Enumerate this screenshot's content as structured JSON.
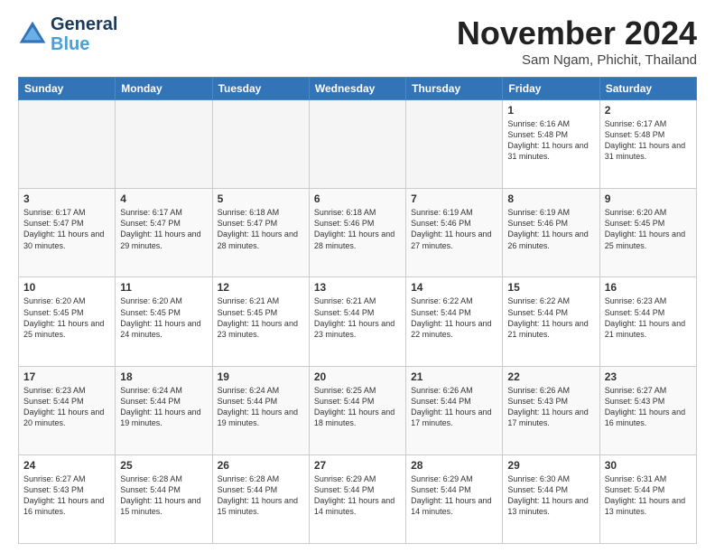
{
  "header": {
    "logo_line1": "General",
    "logo_line2": "Blue",
    "title": "November 2024",
    "location": "Sam Ngam, Phichit, Thailand"
  },
  "weekdays": [
    "Sunday",
    "Monday",
    "Tuesday",
    "Wednesday",
    "Thursday",
    "Friday",
    "Saturday"
  ],
  "weeks": [
    [
      {
        "day": "",
        "info": ""
      },
      {
        "day": "",
        "info": ""
      },
      {
        "day": "",
        "info": ""
      },
      {
        "day": "",
        "info": ""
      },
      {
        "day": "",
        "info": ""
      },
      {
        "day": "1",
        "info": "Sunrise: 6:16 AM\nSunset: 5:48 PM\nDaylight: 11 hours\nand 31 minutes."
      },
      {
        "day": "2",
        "info": "Sunrise: 6:17 AM\nSunset: 5:48 PM\nDaylight: 11 hours\nand 31 minutes."
      }
    ],
    [
      {
        "day": "3",
        "info": "Sunrise: 6:17 AM\nSunset: 5:47 PM\nDaylight: 11 hours\nand 30 minutes."
      },
      {
        "day": "4",
        "info": "Sunrise: 6:17 AM\nSunset: 5:47 PM\nDaylight: 11 hours\nand 29 minutes."
      },
      {
        "day": "5",
        "info": "Sunrise: 6:18 AM\nSunset: 5:47 PM\nDaylight: 11 hours\nand 28 minutes."
      },
      {
        "day": "6",
        "info": "Sunrise: 6:18 AM\nSunset: 5:46 PM\nDaylight: 11 hours\nand 28 minutes."
      },
      {
        "day": "7",
        "info": "Sunrise: 6:19 AM\nSunset: 5:46 PM\nDaylight: 11 hours\nand 27 minutes."
      },
      {
        "day": "8",
        "info": "Sunrise: 6:19 AM\nSunset: 5:46 PM\nDaylight: 11 hours\nand 26 minutes."
      },
      {
        "day": "9",
        "info": "Sunrise: 6:20 AM\nSunset: 5:45 PM\nDaylight: 11 hours\nand 25 minutes."
      }
    ],
    [
      {
        "day": "10",
        "info": "Sunrise: 6:20 AM\nSunset: 5:45 PM\nDaylight: 11 hours\nand 25 minutes."
      },
      {
        "day": "11",
        "info": "Sunrise: 6:20 AM\nSunset: 5:45 PM\nDaylight: 11 hours\nand 24 minutes."
      },
      {
        "day": "12",
        "info": "Sunrise: 6:21 AM\nSunset: 5:45 PM\nDaylight: 11 hours\nand 23 minutes."
      },
      {
        "day": "13",
        "info": "Sunrise: 6:21 AM\nSunset: 5:44 PM\nDaylight: 11 hours\nand 23 minutes."
      },
      {
        "day": "14",
        "info": "Sunrise: 6:22 AM\nSunset: 5:44 PM\nDaylight: 11 hours\nand 22 minutes."
      },
      {
        "day": "15",
        "info": "Sunrise: 6:22 AM\nSunset: 5:44 PM\nDaylight: 11 hours\nand 21 minutes."
      },
      {
        "day": "16",
        "info": "Sunrise: 6:23 AM\nSunset: 5:44 PM\nDaylight: 11 hours\nand 21 minutes."
      }
    ],
    [
      {
        "day": "17",
        "info": "Sunrise: 6:23 AM\nSunset: 5:44 PM\nDaylight: 11 hours\nand 20 minutes."
      },
      {
        "day": "18",
        "info": "Sunrise: 6:24 AM\nSunset: 5:44 PM\nDaylight: 11 hours\nand 19 minutes."
      },
      {
        "day": "19",
        "info": "Sunrise: 6:24 AM\nSunset: 5:44 PM\nDaylight: 11 hours\nand 19 minutes."
      },
      {
        "day": "20",
        "info": "Sunrise: 6:25 AM\nSunset: 5:44 PM\nDaylight: 11 hours\nand 18 minutes."
      },
      {
        "day": "21",
        "info": "Sunrise: 6:26 AM\nSunset: 5:44 PM\nDaylight: 11 hours\nand 17 minutes."
      },
      {
        "day": "22",
        "info": "Sunrise: 6:26 AM\nSunset: 5:43 PM\nDaylight: 11 hours\nand 17 minutes."
      },
      {
        "day": "23",
        "info": "Sunrise: 6:27 AM\nSunset: 5:43 PM\nDaylight: 11 hours\nand 16 minutes."
      }
    ],
    [
      {
        "day": "24",
        "info": "Sunrise: 6:27 AM\nSunset: 5:43 PM\nDaylight: 11 hours\nand 16 minutes."
      },
      {
        "day": "25",
        "info": "Sunrise: 6:28 AM\nSunset: 5:44 PM\nDaylight: 11 hours\nand 15 minutes."
      },
      {
        "day": "26",
        "info": "Sunrise: 6:28 AM\nSunset: 5:44 PM\nDaylight: 11 hours\nand 15 minutes."
      },
      {
        "day": "27",
        "info": "Sunrise: 6:29 AM\nSunset: 5:44 PM\nDaylight: 11 hours\nand 14 minutes."
      },
      {
        "day": "28",
        "info": "Sunrise: 6:29 AM\nSunset: 5:44 PM\nDaylight: 11 hours\nand 14 minutes."
      },
      {
        "day": "29",
        "info": "Sunrise: 6:30 AM\nSunset: 5:44 PM\nDaylight: 11 hours\nand 13 minutes."
      },
      {
        "day": "30",
        "info": "Sunrise: 6:31 AM\nSunset: 5:44 PM\nDaylight: 11 hours\nand 13 minutes."
      }
    ]
  ]
}
